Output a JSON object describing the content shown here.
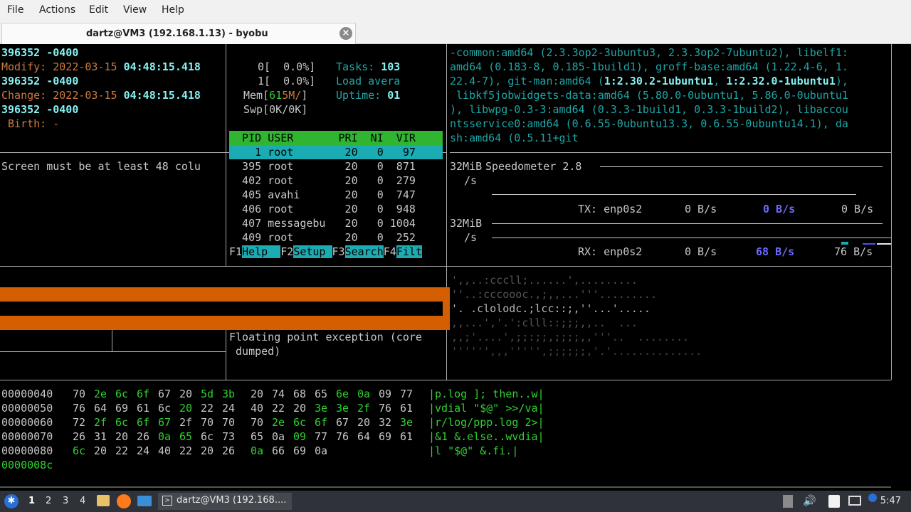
{
  "menu": {
    "file": "File",
    "actions": "Actions",
    "edit": "Edit",
    "view": "View",
    "help": "Help"
  },
  "tab": {
    "title": "dartz@VM3 (192.168.1.13) - byobu",
    "close": "×"
  },
  "stat": {
    "line1": "396352 -0400",
    "modify_label": "Modify: ",
    "modify_date": "2022-03-15 ",
    "modify_time": "04:48:15.418",
    "line3": "396352 -0400",
    "change_label": "Change: ",
    "change_date": "2022-03-15 ",
    "change_time": "04:48:15.418",
    "line5": "396352 -0400",
    "birth": " Birth: -"
  },
  "warning": "Screen must be at least 48 colu",
  "htop": {
    "cpu0": "0[  0.0%]",
    "cpu1": "1[  0.0%]",
    "mem_pre": "Mem[",
    "mem_a": "61",
    "mem_b": "5M/",
    "mem_post": "]",
    "swp": "Swp[0K/0K]",
    "tasks_label": "Tasks: ",
    "tasks_value": "103",
    "load_label": "Load avera",
    "uptime_label": "Uptime: ",
    "uptime_value": "01",
    "header": "  PID USER       PRI  NI  VIR",
    "rows": [
      "    1 root        20   0   97",
      "  395 root        20   0  871",
      "  402 root        20   0  279",
      "  405 avahi       20   0  747",
      "  406 root        20   0  948",
      "  407 messagebu   20   0 1004",
      "  409 root        20   0  252"
    ],
    "fkeys": [
      {
        "key": "F1",
        "label": "Help  "
      },
      {
        "key": "F2",
        "label": "Setup "
      },
      {
        "key": "F3",
        "label": "Search"
      },
      {
        "key": "F4",
        "label": "Filt"
      }
    ]
  },
  "apt": [
    "-common:amd64 (2.3.3op2-3ubuntu3, 2.3.3op2-7ubuntu2), libelf1:",
    "amd64 (0.183-8, 0.185-1build1), groff-base:amd64 (1.22.4-6, 1.",
    "22.4-7), git-man:amd64 (",
    "1:2.30.2-1ubuntu1",
    ", ",
    "1:2.32.0-1ubuntu1",
    "),",
    " libkf5jobwidgets-data:amd64 (5.80.0-0ubuntu1, 5.86.0-0ubuntu1",
    "), libwpg-0.3-3:amd64 (0.3.3-1build1, 0.3.3-1build2), libaccou",
    "ntsservice0:amd64 (0.6.55-0ubuntu13.3, 0.6.55-0ubuntu14.1), da",
    "sh:amd64 (0.5.11+git"
  ],
  "speed": {
    "title": "Speedometer 2.8",
    "scale1": "32MiB",
    "unit1": "/s",
    "scale2": "32MiB",
    "unit2": "/s",
    "tx_label": "TX: enp0s2",
    "tx_v1": "0 B/s",
    "tx_v2": "0 B/s",
    "tx_v3": "0 B/s",
    "rx_label": "RX: enp0s2",
    "rx_v1": "0 B/s",
    "rx_v2": "68 B/s",
    "rx_v3": "76 B/s"
  },
  "fpe": {
    "line1": "Floating point exception (core",
    "line2": " dumped)"
  },
  "ascii_art": [
    "',,..:cccll;......',.........",
    "''..:cccoooc.,;,,...'''.........",
    "'. .clolodc.;lcc::;,''...'.....",
    ",,...','.':clll::;;;,,..  ...",
    ",,;'....',;;:;;,;;;;,,'''..  ........",
    "'''''',,,''''',;;;;;;,'.'.............."
  ],
  "hexdump": [
    {
      "addr": "00000040",
      "bytes": [
        "70",
        "2e",
        "6c",
        "6f",
        "67",
        "20",
        "5d",
        "3b",
        "20",
        "74",
        "68",
        "65",
        "6e",
        "0a",
        "09",
        "77"
      ],
      "ascii": "|p.log ]; then..w|"
    },
    {
      "addr": "00000050",
      "bytes": [
        "76",
        "64",
        "69",
        "61",
        "6c",
        "20",
        "22",
        "24",
        "40",
        "22",
        "20",
        "3e",
        "3e",
        "2f",
        "76",
        "61"
      ],
      "ascii": "|vdial \"$@\" >>/va|"
    },
    {
      "addr": "00000060",
      "bytes": [
        "72",
        "2f",
        "6c",
        "6f",
        "67",
        "2f",
        "70",
        "70",
        "70",
        "2e",
        "6c",
        "6f",
        "67",
        "20",
        "32",
        "3e"
      ],
      "ascii": "|r/log/ppp.log 2>|"
    },
    {
      "addr": "00000070",
      "bytes": [
        "26",
        "31",
        "20",
        "26",
        "0a",
        "65",
        "6c",
        "73",
        "65",
        "0a",
        "09",
        "77",
        "76",
        "64",
        "69",
        "61"
      ],
      "ascii": "|&1 &.else..wvdia|"
    },
    {
      "addr": "00000080",
      "bytes": [
        "6c",
        "20",
        "22",
        "24",
        "40",
        "22",
        "20",
        "26",
        "0a",
        "66",
        "69",
        "0a"
      ],
      "ascii": "|l \"$@\" &.fi.|"
    }
  ],
  "hex_end": "0000008c",
  "taskbar": {
    "workspaces": [
      "1",
      "2",
      "3",
      "4"
    ],
    "app_label": "dartz@VM3 (192.168....",
    "time": "5:47"
  },
  "colors": {
    "orange": "#d55e00",
    "cyan": "#1aacb2",
    "green": "#2fd12f",
    "teal": "#23a7a7",
    "date": "#c87b3e",
    "bright_cyan": "#84f0f0",
    "blue_bold": "#6b6bff"
  }
}
